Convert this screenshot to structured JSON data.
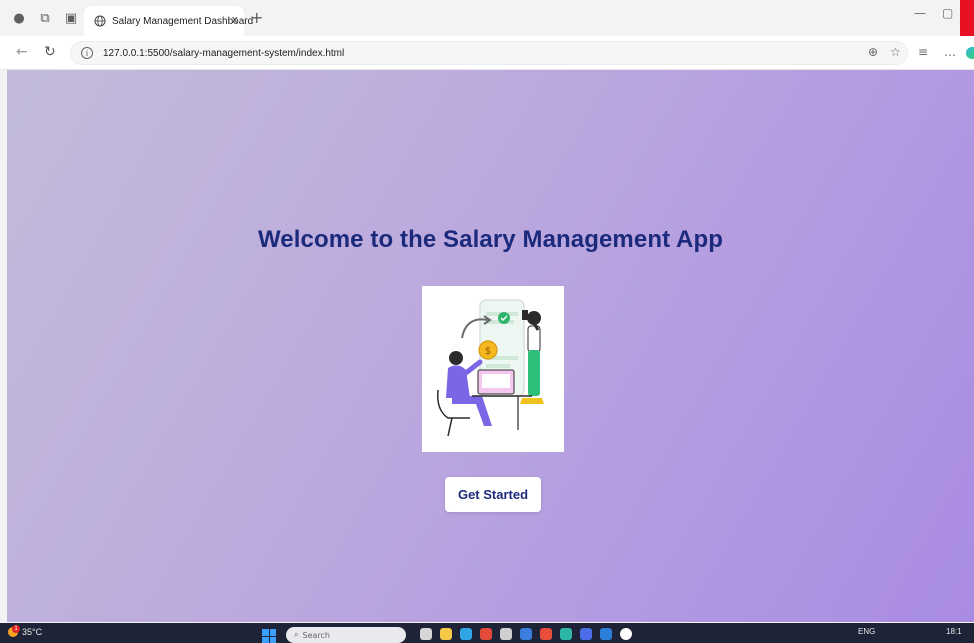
{
  "browser": {
    "tab_title": "Salary Management Dashboard",
    "tab_close": "x",
    "new_tab": "+",
    "url": "127.0.0.1:5500/salary-management-system/index.html"
  },
  "page": {
    "heading": "Welcome to the Salary Management App",
    "cta_label": "Get Started",
    "illustration": "salary-payment-illustration",
    "accent_color": "#1c2a7c"
  },
  "taskbar": {
    "temperature": "35°C",
    "weather_badge": "1",
    "search_placeholder": "Search",
    "language": "ENG",
    "clock": "18:1"
  },
  "icons": [
    "profile-icon",
    "workspaces-icon",
    "tab-actions-icon",
    "globe-icon",
    "back-icon",
    "refresh-icon",
    "info-icon",
    "zoom-icon",
    "favorite-icon",
    "collections-icon",
    "more-icon",
    "edge-icon",
    "windows-start-icon"
  ]
}
